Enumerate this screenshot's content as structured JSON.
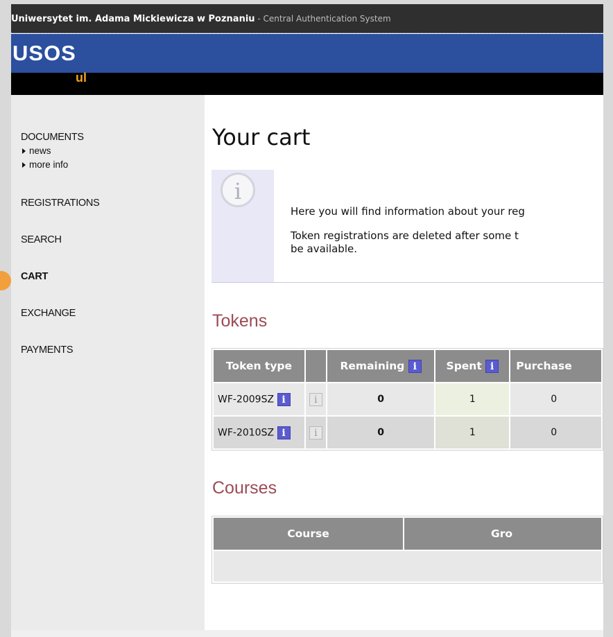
{
  "header": {
    "university": "Uniwersytet im. Adama Mickiewicza w Poznaniu",
    "separator": " - ",
    "system": "Central Authentication System"
  },
  "logo": {
    "main": "USOS",
    "sub": "ul"
  },
  "sidebar": {
    "items": [
      {
        "label": "DOCUMENTS",
        "sub": [
          "news",
          "more info"
        ]
      },
      {
        "label": "REGISTRATIONS"
      },
      {
        "label": "SEARCH"
      },
      {
        "label": "CART",
        "active": true
      },
      {
        "label": "EXCHANGE"
      },
      {
        "label": "PAYMENTS"
      }
    ]
  },
  "page": {
    "title": "Your cart",
    "info_icon": "i",
    "info_lines": [
      "Here you will find information about your reg",
      "Token registrations are deleted after some t",
      "be available."
    ]
  },
  "tokens": {
    "title": "Tokens",
    "columns": [
      "Token type",
      "",
      "Remaining",
      "Spent",
      "Purchase"
    ],
    "info_glyph": "i",
    "rows": [
      {
        "type": "WF-2009SZ",
        "remaining": "0",
        "spent": "1",
        "purchased": "0"
      },
      {
        "type": "WF-2010SZ",
        "remaining": "0",
        "spent": "1",
        "purchased": "0"
      }
    ]
  },
  "courses": {
    "title": "Courses",
    "columns": [
      "Course",
      "Gro"
    ]
  },
  "colors": {
    "topbar": "#2f2f2f",
    "brand_blue": "#2c4f9e",
    "accent_orange": "#f2a03d",
    "section_title": "#9c4b55",
    "table_header": "#8c8c8c"
  },
  "icons": [
    "info-icon",
    "active-nav-marker",
    "expand-triangle-icon"
  ]
}
